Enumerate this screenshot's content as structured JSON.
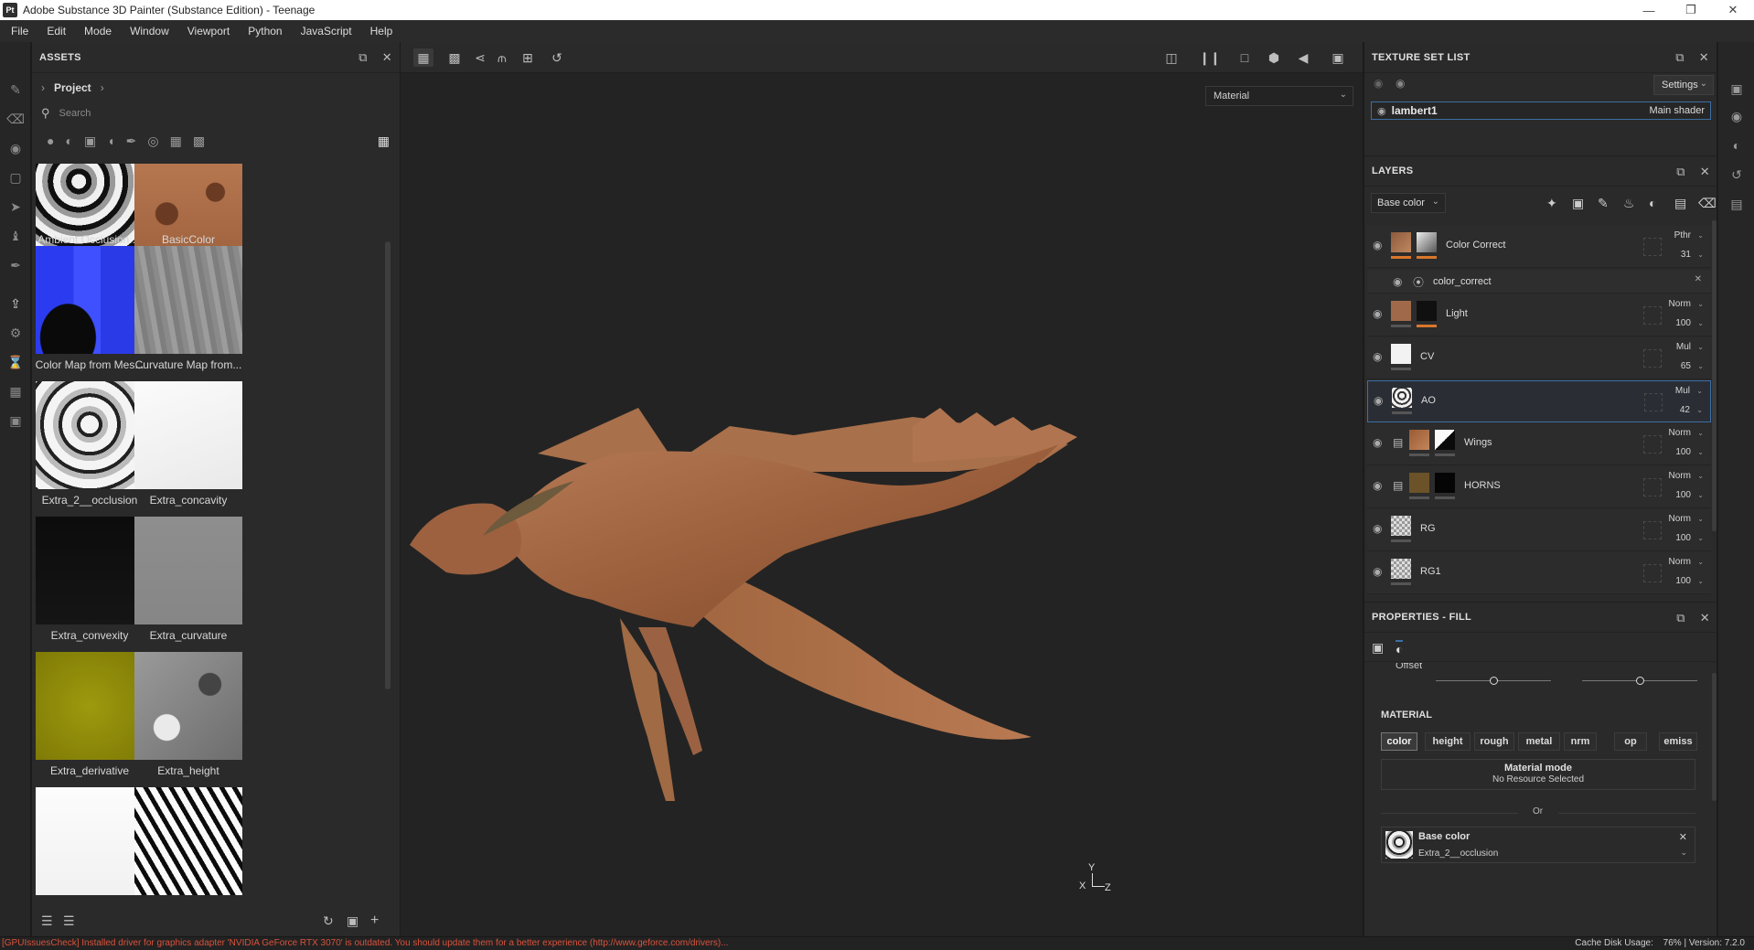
{
  "window": {
    "app_icon": "Pt",
    "title": "Adobe Substance 3D Painter (Substance Edition) - Teenage",
    "controls": [
      "minimize-icon",
      "maximize-icon",
      "close-icon"
    ]
  },
  "menu": [
    "File",
    "Edit",
    "Mode",
    "Window",
    "Viewport",
    "Python",
    "JavaScript",
    "Help"
  ],
  "assets": {
    "title": "ASSETS",
    "breadcrumb": "Project",
    "search_placeholder": "Search",
    "items": [
      {
        "label": "Ambient Occlusion ...",
        "style": "ao"
      },
      {
        "label": "BasicColor",
        "style": "basic"
      },
      {
        "label": "Color Map from Mes...",
        "style": "colormap"
      },
      {
        "label": "Curvature Map from...",
        "style": "curvature"
      },
      {
        "label": "Extra_2__occlusion",
        "style": "occlusion"
      },
      {
        "label": "Extra_concavity",
        "style": "concavity"
      },
      {
        "label": "Extra_convexity",
        "style": "convexity"
      },
      {
        "label": "Extra_curvature",
        "style": "excurvature"
      },
      {
        "label": "Extra_derivative",
        "style": "derivative"
      },
      {
        "label": "Extra_height",
        "style": "height"
      },
      {
        "label": "",
        "style": "white"
      },
      {
        "label": "",
        "style": "zebra"
      }
    ]
  },
  "viewport": {
    "material_select": "Material",
    "axis": {
      "y": "Y",
      "x": "X",
      "z": "Z"
    }
  },
  "texture_set_list": {
    "title": "TEXTURE SET LIST",
    "settings_label": "Settings",
    "set_name": "lambert1",
    "shader": "Main shader"
  },
  "layers": {
    "title": "LAYERS",
    "channel_select": "Base color",
    "rows": [
      {
        "name": "Color Correct",
        "blend": "Pthr",
        "opacity": "31",
        "folder": false,
        "t1": "#8c5a3c",
        "t2": "#d8d8d8",
        "bar1": "#d9772b",
        "bar2": "#d9772b",
        "selected": false
      },
      {
        "name": "Light",
        "blend": "Norm",
        "opacity": "100",
        "folder": false,
        "t1": "#a06a4a",
        "t2": "#101010",
        "bar1": "#555555",
        "bar2": "#d9772b",
        "selected": false
      },
      {
        "name": "CV",
        "blend": "Mul",
        "opacity": "65",
        "folder": false,
        "t1": "#f2f2f2",
        "t2": "",
        "bar1": "#555555",
        "bar2": "",
        "selected": false
      },
      {
        "name": "AO",
        "blend": "Mul",
        "opacity": "42",
        "folder": false,
        "t1": "#cfcfcf",
        "t2": "",
        "bar1": "#555555",
        "bar2": "",
        "selected": true
      },
      {
        "name": "Wings",
        "blend": "Norm",
        "opacity": "100",
        "folder": true,
        "t1": "#9a5b35",
        "t2": "#e8e8e8",
        "bar1": "#555555",
        "bar2": "#555555",
        "selected": false
      },
      {
        "name": "HORNS",
        "blend": "Norm",
        "opacity": "100",
        "folder": true,
        "t1": "#6b5228",
        "t2": "#050505",
        "bar1": "#555555",
        "bar2": "#555555",
        "selected": false
      },
      {
        "name": "RG",
        "blend": "Norm",
        "opacity": "100",
        "folder": false,
        "t1": "checker",
        "t2": "",
        "bar1": "#555555",
        "bar2": "",
        "selected": false
      },
      {
        "name": "RG1",
        "blend": "Norm",
        "opacity": "100",
        "folder": false,
        "t1": "checker",
        "t2": "",
        "bar1": "#555555",
        "bar2": "",
        "selected": false
      }
    ],
    "sublayer": {
      "name": "color_correct"
    }
  },
  "properties": {
    "title": "PROPERTIES - FILL",
    "offset_label": "Offset",
    "offset_slider_1": 0.5,
    "offset_slider_2": 0.5,
    "material_heading": "MATERIAL",
    "channels": [
      "color",
      "height",
      "rough",
      "metal",
      "nrm",
      "op",
      "emiss"
    ],
    "active_channel": "color",
    "material_mode_title": "Material mode",
    "material_mode_value": "No Resource Selected",
    "or_label": "Or",
    "base_color_title": "Base color",
    "base_color_resource": "Extra_2__occlusion"
  },
  "status": {
    "message": "[GPUIssuesCheck] Installed driver for graphics adapter 'NVIDIA GeForce RTX 3070' is outdated. You should update them for a better experience (http://www.geforce.com/drivers)...",
    "cache_label": "Cache Disk Usage:",
    "cache_value": "76%",
    "version": "Version: 7.2.0"
  },
  "colors": {
    "accent_blue": "#3d6ea5",
    "accent_orange": "#d9772b",
    "error_red": "#d9533c",
    "creature_base": "#9b5f3c"
  }
}
